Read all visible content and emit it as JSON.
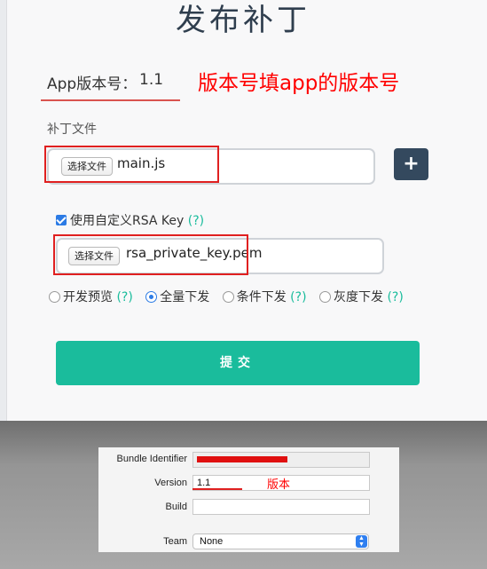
{
  "form": {
    "title": "发布补丁",
    "version_label": "App版本号：",
    "version_value": "1.1",
    "version_note": "版本号填app的版本号",
    "patch_label": "补丁文件",
    "patch_file": {
      "choose_label": "选择文件",
      "file_name": "main.js"
    },
    "add_button_icon": "plus-icon",
    "add_button_label": "+",
    "rsa": {
      "checked": true,
      "label": "使用自定义RSA Key",
      "help": "(?)"
    },
    "key_file": {
      "choose_label": "选择文件",
      "file_name": "rsa_private_key.pem"
    },
    "modes": [
      {
        "label": "开发预览",
        "help": "(?)",
        "selected": false
      },
      {
        "label": "全量下发",
        "help": "",
        "selected": true
      },
      {
        "label": "条件下发",
        "help": "(?)",
        "selected": false
      },
      {
        "label": "灰度下发",
        "help": "(?)",
        "selected": false
      }
    ],
    "submit_label": "提交",
    "colors": {
      "title": "#2f3e4e",
      "accent": "#1abc9c",
      "dark_button": "#34495e",
      "annotation": "#ff0000"
    }
  },
  "xcode": {
    "bundle_label": "Bundle Identifier",
    "version_label": "Version",
    "version_value": "1.1",
    "version_note": "版本",
    "build_label": "Build",
    "build_value": "",
    "team_label": "Team",
    "team_value": "None"
  }
}
